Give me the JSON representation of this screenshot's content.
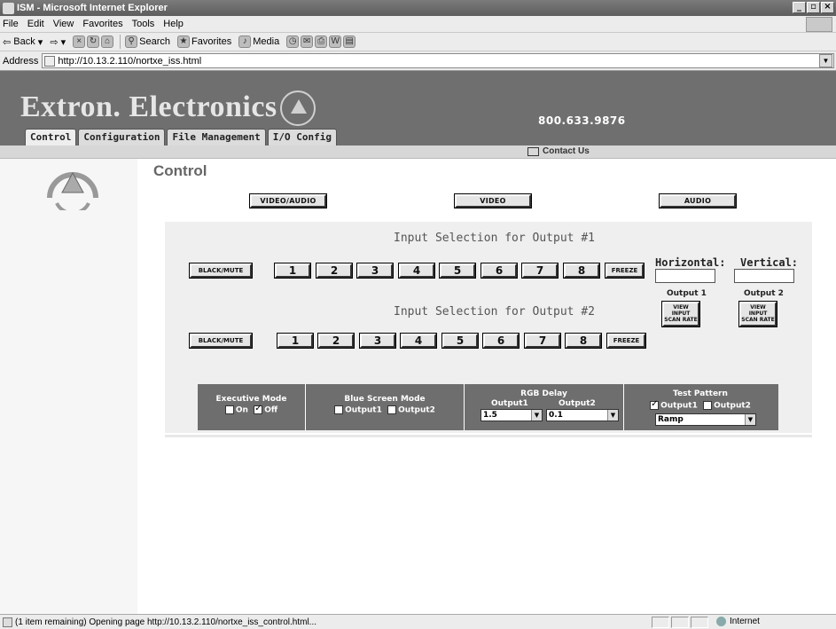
{
  "window": {
    "title": "ISM - Microsoft Internet Explorer",
    "buttons": [
      "_",
      "▫",
      "×"
    ]
  },
  "menu": [
    "File",
    "Edit",
    "View",
    "Favorites",
    "Tools",
    "Help"
  ],
  "toolbar": {
    "back": "Back",
    "search": "Search",
    "favorites": "Favorites",
    "media": "Media"
  },
  "address": {
    "label": "Address",
    "url": "http://10.13.2.110/nortxe_iss.html"
  },
  "site": {
    "brand": "Extron. Electronics",
    "phone": "800.633.9876",
    "tabs": [
      "Control",
      "Configuration",
      "File Management",
      "I/O Config"
    ],
    "contact": "Contact Us"
  },
  "control": {
    "title": "Control",
    "mode_buttons": [
      "VIDEO/AUDIO",
      "VIDEO",
      "AUDIO"
    ],
    "output1_title": "Input Selection for Output #1",
    "output2_title": "Input Selection for Output #2",
    "black_mute": "BLACK/MUTE",
    "freeze": "FREEZE",
    "inputs": [
      "1",
      "2",
      "3",
      "4",
      "5",
      "6",
      "7",
      "8"
    ],
    "horizontal_label": "Horizontal:",
    "vertical_label": "Vertical:",
    "output1_label": "Output 1",
    "output2_label": "Output 2",
    "scan_rate_btn": "VIEW INPUT SCAN RATE"
  },
  "modes": {
    "executive": {
      "title": "Executive Mode",
      "on": "On",
      "off": "Off",
      "on_checked": false,
      "off_checked": true
    },
    "blue_screen": {
      "title": "Blue Screen Mode",
      "output1": "Output1",
      "output2": "Output2"
    },
    "rgb_delay": {
      "title": "RGB Delay",
      "output1": "Output1",
      "output2": "Output2",
      "value1": "1.5",
      "value2": "0.1"
    },
    "test_pattern": {
      "title": "Test Pattern",
      "output1": "Output1",
      "output2": "Output2",
      "output1_checked": true,
      "value": "Ramp"
    }
  },
  "status": {
    "text": "(1 item remaining) Opening page http://10.13.2.110/nortxe_iss_control.html...",
    "zone": "Internet"
  }
}
